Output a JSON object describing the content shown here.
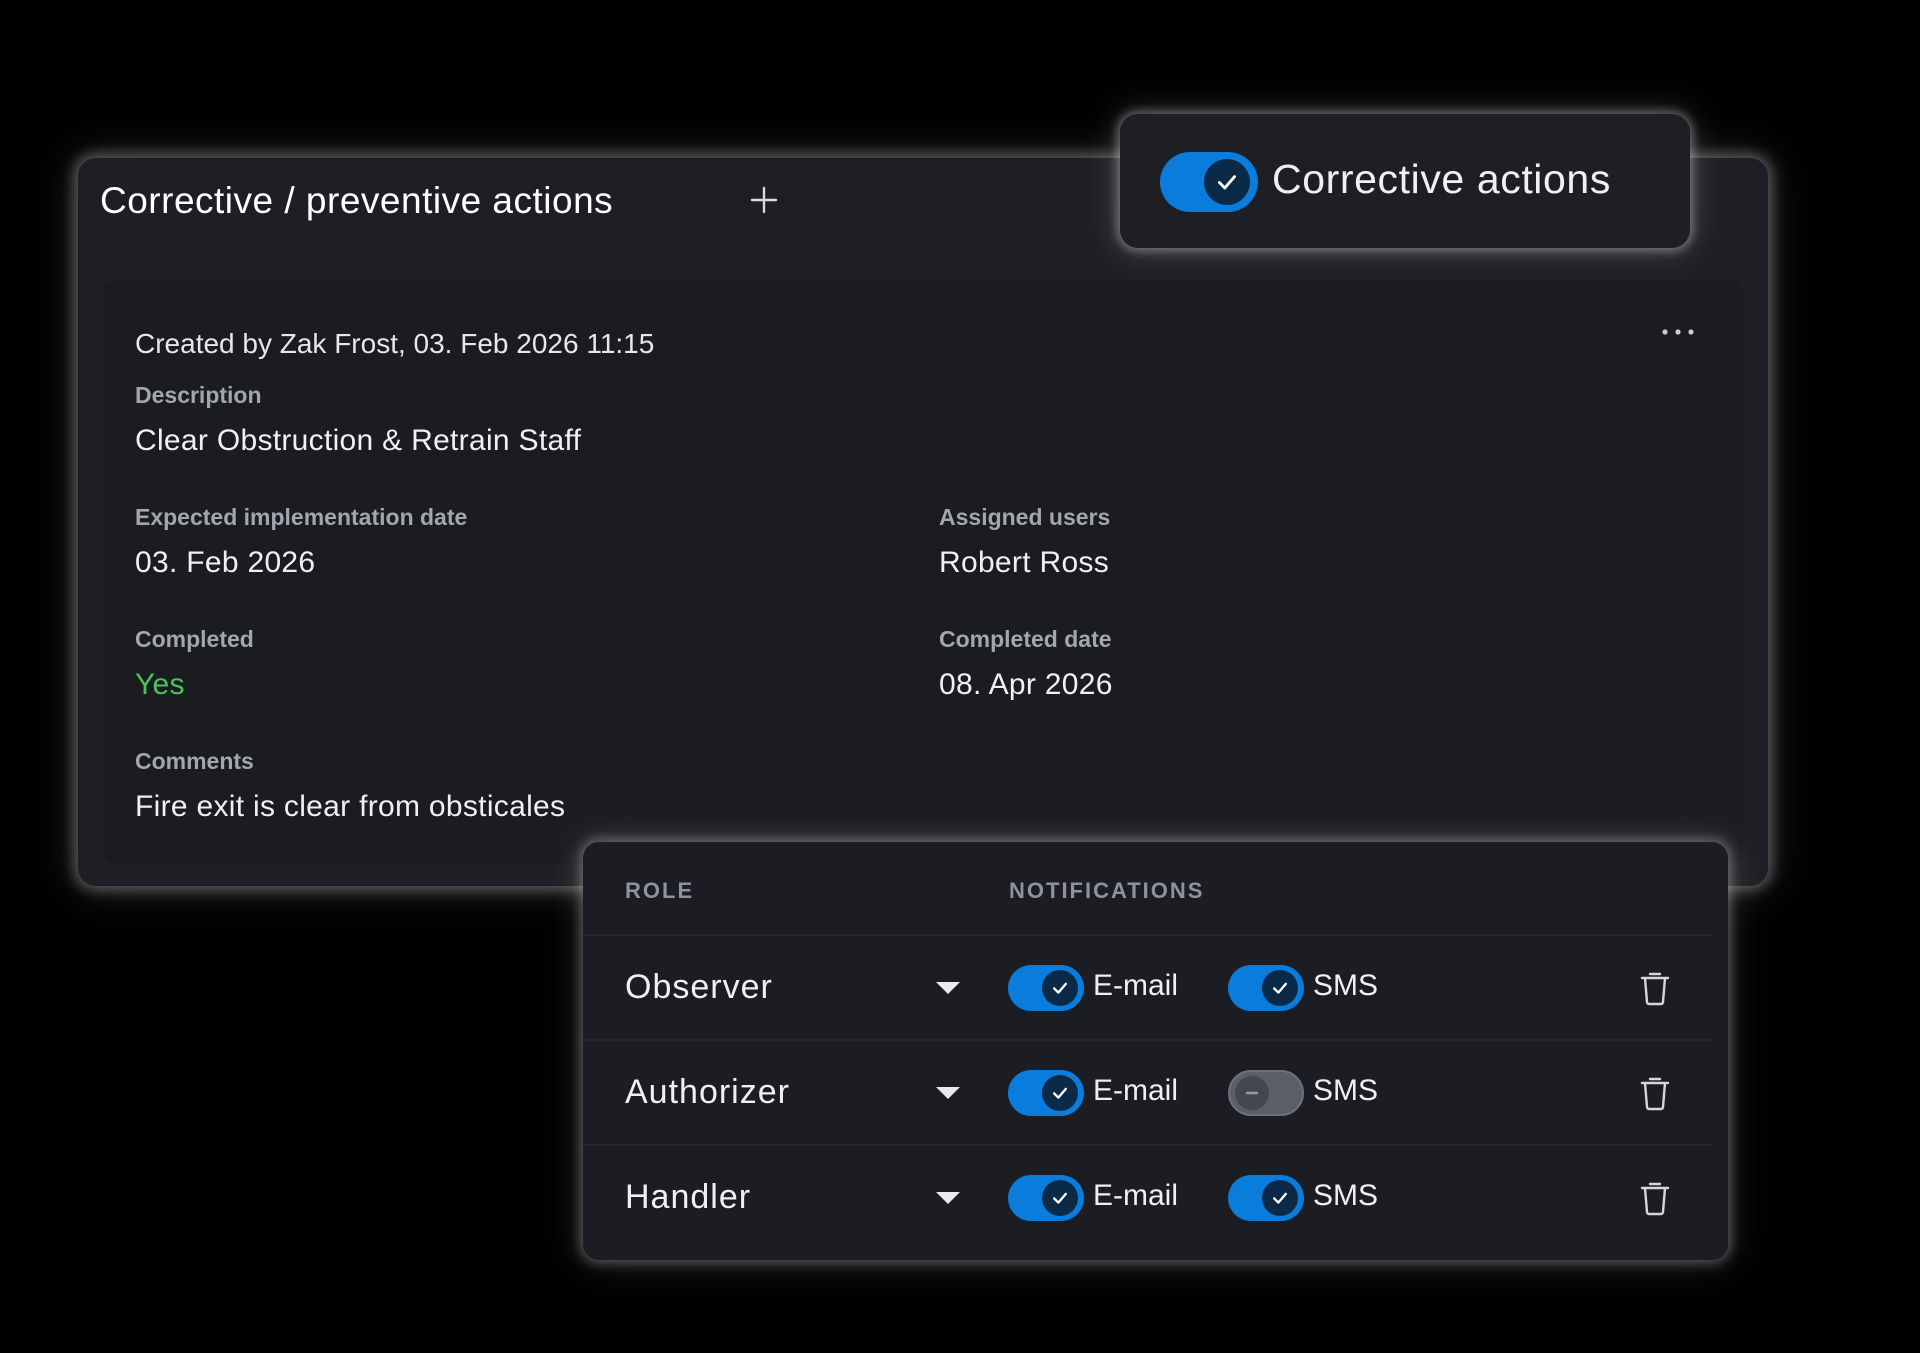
{
  "main_card": {
    "title": "Corrective / preventive actions",
    "add_icon": "plus-icon",
    "action": {
      "created": "Created by Zak Frost, 03. Feb 2026 11:15",
      "more_icon": "more-horizontal-icon",
      "description_label": "Description",
      "description_value": "Clear Obstruction & Retrain Staff",
      "expected_date_label": "Expected implementation date",
      "expected_date_value": "03. Feb 2026",
      "assigned_users_label": "Assigned users",
      "assigned_users_value": "Robert Ross",
      "completed_label": "Completed",
      "completed_value": "Yes",
      "completed_date_label": "Completed date",
      "completed_date_value": "08. Apr 2026",
      "comments_label": "Comments",
      "comments_value": "Fire exit is clear from obsticales"
    }
  },
  "toggle_popup": {
    "label": "Corrective actions",
    "enabled": true
  },
  "roles_panel": {
    "role_header": "ROLE",
    "notifications_header": "NOTIFICATIONS",
    "email_label": "E-mail",
    "sms_label": "SMS",
    "rows": [
      {
        "role": "Observer",
        "email": true,
        "sms": true
      },
      {
        "role": "Authorizer",
        "email": true,
        "sms": false
      },
      {
        "role": "Handler",
        "email": true,
        "sms": true
      }
    ]
  },
  "colors": {
    "accent": "#0a7cdc",
    "success": "#4cc25a",
    "card_background": "#1d1f24",
    "page_background": "#000000"
  }
}
